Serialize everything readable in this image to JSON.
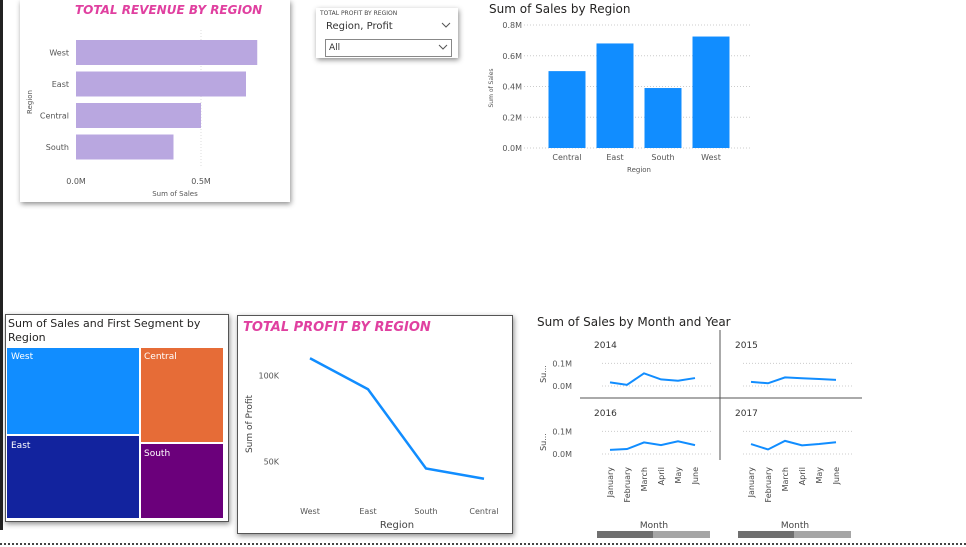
{
  "colors": {
    "accent_blue": "#118dff",
    "bar_purple": "#b9a7e0",
    "title_pink": "#e040a0",
    "tree_west": "#118dff",
    "tree_central": "#e66c37",
    "tree_east": "#12239e",
    "tree_south": "#6b007b"
  },
  "revenue_card": {
    "title": "TOTAL REVENUE BY REGION",
    "y_axis_title": "Region",
    "x_axis_title": "Sum of Sales"
  },
  "slicer": {
    "header": "TOTAL PROFIT BY REGION",
    "field": "Region, Profit",
    "selected": "All"
  },
  "sales_card": {
    "title": "Sum of Sales by Region",
    "y_axis_title": "Sum of Sales",
    "x_axis_title": "Region"
  },
  "treemap_card": {
    "title": "Sum of Sales and First Segment by Region",
    "tiles": [
      "West",
      "Central",
      "East",
      "South"
    ]
  },
  "profit_card": {
    "title": "TOTAL PROFIT BY REGION",
    "y_axis_title": "Sum of Profit",
    "x_axis_title": "Region"
  },
  "month_card": {
    "title": "Sum of Sales by Month and Year",
    "y_axis_title": "Su...",
    "x_axis_title": "Month",
    "years": [
      "2014",
      "2015",
      "2016",
      "2017"
    ]
  },
  "chart_data": [
    {
      "type": "bar",
      "title": "TOTAL REVENUE BY REGION",
      "orientation": "horizontal",
      "categories": [
        "West",
        "East",
        "Central",
        "South"
      ],
      "values": [
        0.725,
        0.68,
        0.5,
        0.39
      ],
      "xlabel": "Sum of Sales",
      "ylabel": "Region",
      "x_ticks": [
        "0.0M",
        "0.5M"
      ],
      "xlim": [
        0,
        1.0
      ]
    },
    {
      "type": "bar",
      "title": "Sum of Sales by Region",
      "categories": [
        "Central",
        "East",
        "South",
        "West"
      ],
      "values": [
        0.5,
        0.68,
        0.39,
        0.725
      ],
      "xlabel": "Region",
      "ylabel": "Sum of Sales",
      "y_ticks": [
        "0.0M",
        "0.2M",
        "0.4M",
        "0.6M",
        "0.8M"
      ],
      "ylim": [
        0,
        0.8
      ]
    },
    {
      "type": "line",
      "title": "TOTAL PROFIT BY REGION",
      "categories": [
        "West",
        "East",
        "South",
        "Central"
      ],
      "values": [
        110000,
        92000,
        46000,
        40000
      ],
      "xlabel": "Region",
      "ylabel": "Sum of Profit",
      "y_ticks": [
        "50K",
        "100K"
      ],
      "ylim": [
        30000,
        120000
      ]
    },
    {
      "type": "line",
      "title": "Sum of Sales by Month and Year",
      "categories": [
        "January",
        "February",
        "March",
        "April",
        "May",
        "June"
      ],
      "y_ticks": [
        "0.0M",
        "0.1M"
      ],
      "ylim": [
        0,
        0.15
      ],
      "series": [
        {
          "name": "2014",
          "values": [
            0.016,
            0.005,
            0.056,
            0.029,
            0.023,
            0.035
          ]
        },
        {
          "name": "2015",
          "values": [
            0.018,
            0.012,
            0.038,
            0.034,
            0.031,
            0.027
          ]
        },
        {
          "name": "2016",
          "values": [
            0.018,
            0.022,
            0.051,
            0.039,
            0.056,
            0.039
          ]
        },
        {
          "name": "2017",
          "values": [
            0.044,
            0.02,
            0.058,
            0.038,
            0.044,
            0.052
          ]
        }
      ]
    }
  ]
}
